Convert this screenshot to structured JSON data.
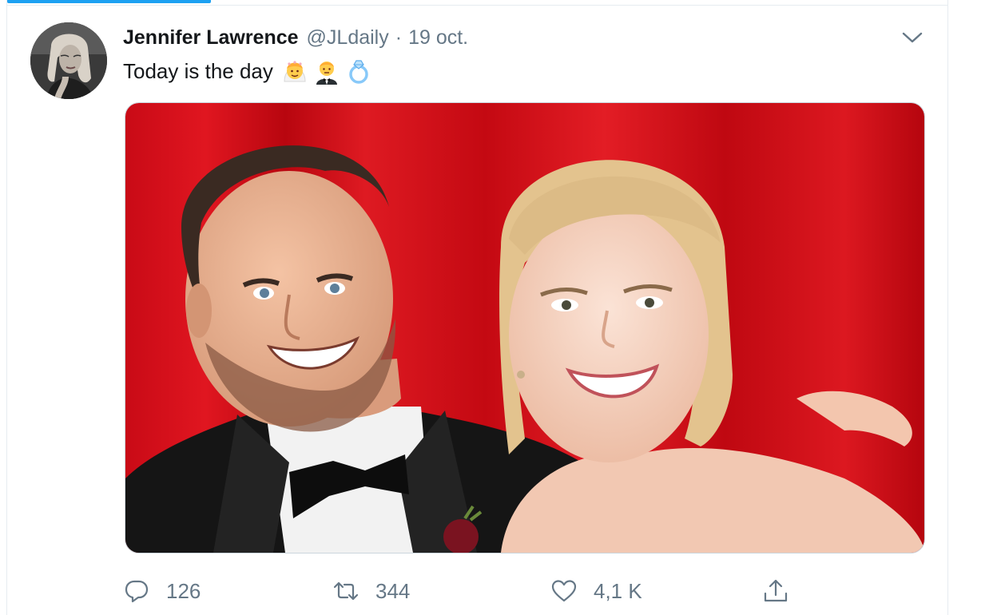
{
  "tweet": {
    "author_name": "Jennifer Lawrence",
    "handle": "@JLdaily",
    "separator": "·",
    "date": "19 oct.",
    "text": "Today is the day",
    "emojis": [
      "bride-with-veil",
      "man-in-tuxedo",
      "ring"
    ]
  },
  "actions": {
    "reply_count": "126",
    "retweet_count": "344",
    "like_count": "4,1 K"
  },
  "colors": {
    "accent": "#1da1f2",
    "secondary_text": "#657786",
    "backdrop_red": "#d0101a"
  },
  "icons": [
    "chevron-down-icon",
    "reply-icon",
    "retweet-icon",
    "heart-icon",
    "share-icon"
  ]
}
